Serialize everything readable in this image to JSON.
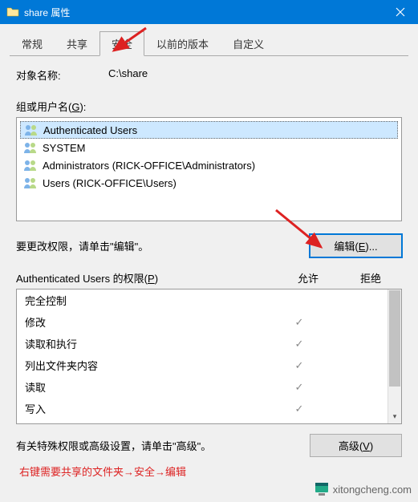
{
  "titlebar": {
    "title": "share 属性"
  },
  "tabs": [
    "常规",
    "共享",
    "安全",
    "以前的版本",
    "自定义"
  ],
  "active_tab_index": 2,
  "object": {
    "label": "对象名称:",
    "value": "C:\\share"
  },
  "groups": {
    "label": "组或用户名(",
    "acc": "G",
    "label_end": "):",
    "items": [
      {
        "text": "Authenticated Users",
        "selected": true
      },
      {
        "text": "SYSTEM",
        "selected": false
      },
      {
        "text": "Administrators (RICK-OFFICE\\Administrators)",
        "selected": false
      },
      {
        "text": "Users (RICK-OFFICE\\Users)",
        "selected": false
      }
    ]
  },
  "edit": {
    "hint": "要更改权限，请单击\"编辑\"。",
    "button_pre": "编辑(",
    "button_acc": "E",
    "button_post": ")..."
  },
  "perm": {
    "header_pre": "Authenticated Users 的权限(",
    "header_acc": "P",
    "header_post": ")",
    "allow": "允许",
    "deny": "拒绝",
    "rows": [
      {
        "name": "完全控制",
        "allow": false,
        "deny": false
      },
      {
        "name": "修改",
        "allow": true,
        "deny": false
      },
      {
        "name": "读取和执行",
        "allow": true,
        "deny": false
      },
      {
        "name": "列出文件夹内容",
        "allow": true,
        "deny": false
      },
      {
        "name": "读取",
        "allow": true,
        "deny": false
      },
      {
        "name": "写入",
        "allow": true,
        "deny": false
      }
    ]
  },
  "adv": {
    "text": "有关特殊权限或高级设置，请单击\"高级\"。",
    "button_pre": "高级(",
    "button_acc": "V",
    "button_post": ")"
  },
  "annotation": "右键需要共享的文件夹→安全→编辑",
  "watermark": {
    "text": "xitongcheng.com"
  },
  "check_glyph": "✓"
}
